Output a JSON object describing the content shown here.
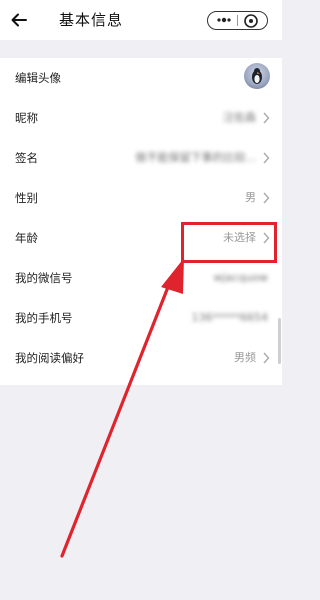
{
  "header": {
    "title": "基本信息",
    "icons": {
      "back": "back-arrow-icon",
      "more": "more-dots-icon",
      "close": "close-target-icon"
    }
  },
  "profile": {
    "rows": [
      {
        "label": "编辑头像",
        "value": "",
        "kind": "avatar"
      },
      {
        "label": "昵称",
        "value": "汪佐森",
        "kind": "blurred"
      },
      {
        "label": "签名",
        "value": "做不能保留下事的比较...",
        "kind": "blurred"
      },
      {
        "label": "性别",
        "value": "男",
        "kind": "text"
      },
      {
        "label": "年龄",
        "value": "未选择",
        "kind": "text"
      },
      {
        "label": "我的微信号",
        "value": "wjacquow",
        "kind": "blurred-nochev"
      },
      {
        "label": "我的手机号",
        "value": "136*****6654",
        "kind": "blurred-nochev"
      },
      {
        "label": "我的阅读偏好",
        "value": "男频",
        "kind": "text"
      }
    ]
  },
  "annotation": {
    "highlight_color": "#e0242d"
  },
  "colors": {
    "page_bg": "#efeff4",
    "row_bg": "#ffffff",
    "muted_text": "#999999"
  }
}
